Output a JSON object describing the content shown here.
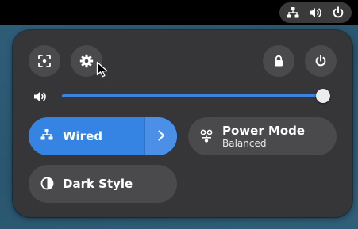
{
  "topbar": {
    "tray_icons": [
      "network-wired-icon",
      "volume-icon",
      "power-icon"
    ]
  },
  "quick_settings": {
    "header_buttons": [
      {
        "name": "screenshot-button",
        "icon": "screenshot-icon"
      },
      {
        "name": "settings-button",
        "icon": "gear-icon"
      },
      {
        "name": "lock-button",
        "icon": "lock-icon"
      },
      {
        "name": "power-off-button",
        "icon": "power-icon"
      }
    ],
    "volume": {
      "icon": "speaker-icon",
      "level": 0.99
    },
    "tiles": {
      "wired": {
        "label": "Wired",
        "icon": "network-wired-icon",
        "active": true,
        "has_menu": true
      },
      "power_mode": {
        "label": "Power Mode",
        "subtitle": "Balanced",
        "icon": "power-mode-icon"
      },
      "dark_style": {
        "label": "Dark Style",
        "icon": "dark-style-icon"
      }
    }
  },
  "colors": {
    "accent": "#3584e4",
    "panel": "#363639",
    "button": "#4a4a4d",
    "topbar": "#000000"
  }
}
